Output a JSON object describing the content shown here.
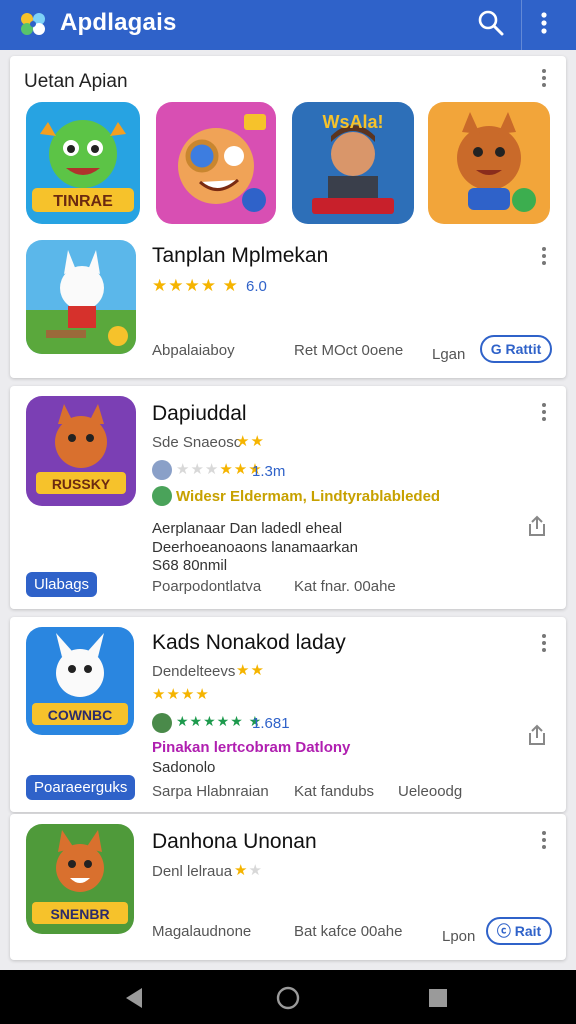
{
  "app_bar": {
    "title": "Apdlagais",
    "logo_icon": "petals-logo-icon",
    "search_icon": "search-icon",
    "more_icon": "more-vert-icon",
    "color": "#2f62c9"
  },
  "section": {
    "title": "Uetan Apian",
    "featured": {
      "title": "Tanplan Mplmekan",
      "rating_stars": "★★★★ ★",
      "rating_value": "6.0",
      "meta_left": "Abpalaiaboy",
      "meta_mid": "Ret MOct 0oene",
      "meta_right": "Lgan",
      "button": "G Rattit"
    }
  },
  "cards": [
    {
      "title": "Dapiuddal",
      "subtitle": "Sde Snaeosc",
      "subtitle_stars": "★★",
      "rating_stars_on": "★★★",
      "rating_stars_off": "★★★",
      "rating_value": "1.3m",
      "highlight": "Widesr Eldermam, Lindtyrablableded",
      "desc1": "Aerplanaar Dan ladedl eheal",
      "desc2": "Deerhoeanoaons lanamaarkan",
      "desc3": "S68 80nmil",
      "tag": "Ulabags",
      "meta_left": "Poarpodontlatva",
      "meta_mid": "Kat fnar. 00ahe"
    },
    {
      "title": "Kads Nonakod laday",
      "subtitle": "Dendelteevs",
      "subtitle_stars": "★★",
      "rating_stars": "★★★★",
      "green_stars": "★★★★★ ★",
      "rating_value": "1.681",
      "highlight": "Pinakan lertcobram Datlony",
      "desc1": "Sadonolo",
      "tag": "Poaraeerguks",
      "meta_left": "Sarpa Hlabnraian",
      "meta_mid": "Kat fandubs",
      "meta_right": "Ueleoodg"
    },
    {
      "title": "Danhona Unonan",
      "subtitle": "Denl lelraua",
      "subtitle_stars_on": "★",
      "subtitle_stars_off": "★",
      "meta_left": "Magalaudnone",
      "meta_mid": "Bat kafce 00ahe",
      "meta_right": "Lpon",
      "button": "ⓒ Rait"
    }
  ],
  "nav": {
    "back_icon": "back-triangle-icon",
    "home_icon": "home-circle-icon",
    "recents_icon": "recents-square-icon"
  }
}
